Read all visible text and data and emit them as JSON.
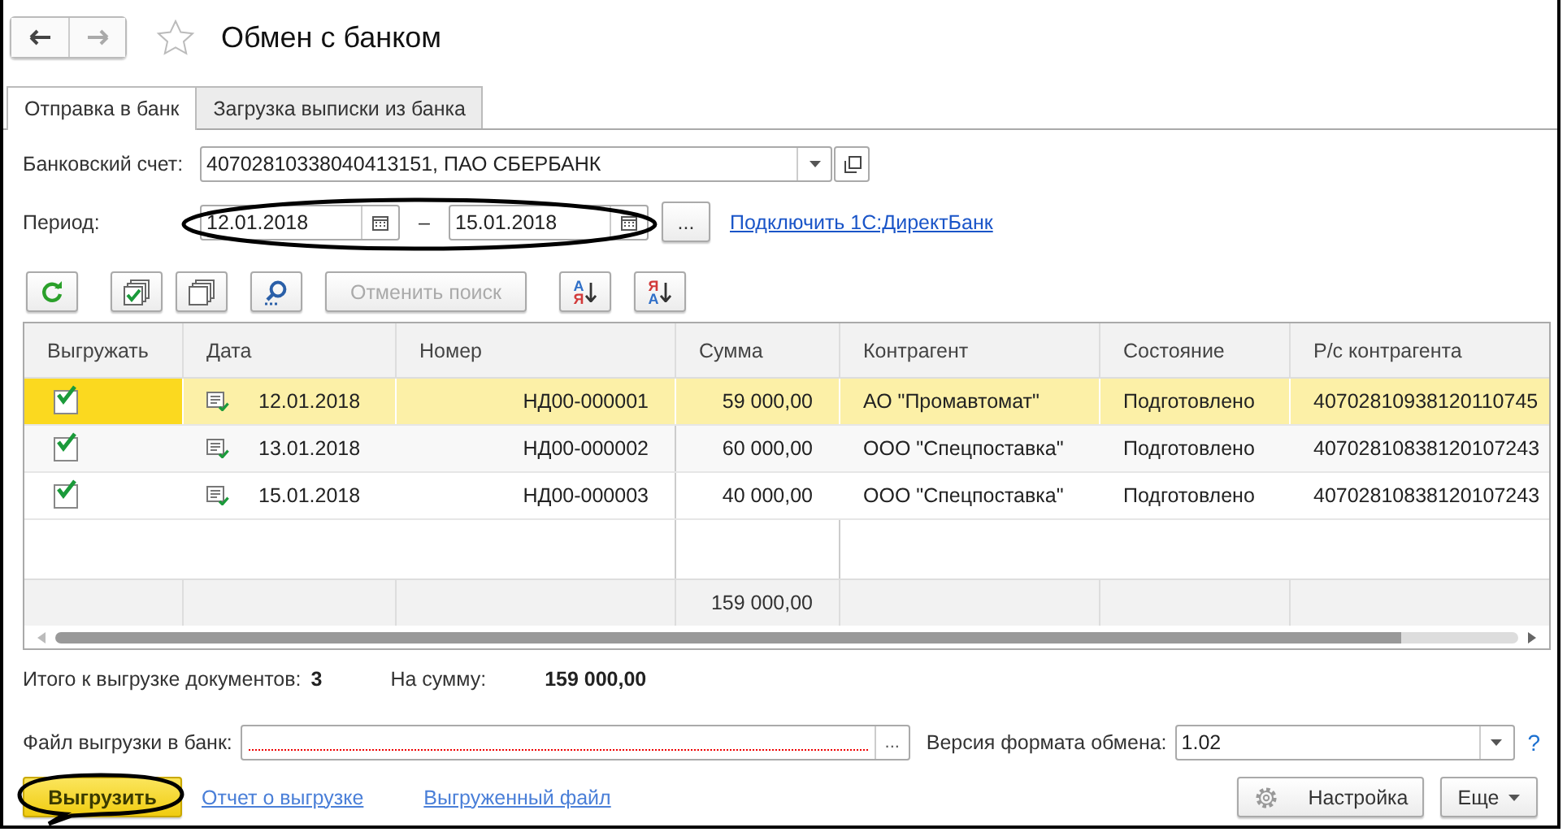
{
  "window": {
    "title": "Обмен с банком",
    "favorite": false
  },
  "tabs": [
    {
      "label": "Отправка в банк",
      "selected": true
    },
    {
      "label": "Загрузка выписки из банка",
      "selected": false
    }
  ],
  "bank_account": {
    "label": "Банковский счет:",
    "value": "40702810338040413151, ПАО СБЕРБАНК"
  },
  "period": {
    "label": "Период:",
    "from": "12.01.2018",
    "separator": "–",
    "to": "15.01.2018",
    "choose_button": "...",
    "circled": true,
    "link": "Подключить 1С:ДиректБанк"
  },
  "toolbar": [
    {
      "kind": "refresh"
    },
    {
      "kind": "check-all"
    },
    {
      "kind": "uncheck-all"
    },
    {
      "kind": "search"
    },
    {
      "kind": "text",
      "label": "Отменить поиск",
      "disabled": true
    },
    {
      "kind": "sort",
      "letters": [
        {
          "char": "А",
          "color": "#2f6fc8"
        },
        {
          "char": "Я",
          "color": "#d23a3a"
        }
      ]
    },
    {
      "kind": "sort",
      "letters": [
        {
          "char": "Я",
          "color": "#d23a3a"
        },
        {
          "char": "А",
          "color": "#2f6fc8"
        }
      ]
    }
  ],
  "table": {
    "columns": [
      "Выгружать",
      "Дата",
      "Номер",
      "Сумма",
      "Контрагент",
      "Состояние",
      "Р/с контрагента"
    ],
    "rows": [
      {
        "export": true,
        "date": "12.01.2018",
        "number": "НД00-000001",
        "sum": "59 000,00",
        "counterparty": "АО \"Промавтомат\"",
        "state": "Подготовлено",
        "account": "40702810938120110745",
        "selected": true
      },
      {
        "export": true,
        "date": "13.01.2018",
        "number": "НД00-000002",
        "sum": "60 000,00",
        "counterparty": "ООО \"Спецпоставка\"",
        "state": "Подготовлено",
        "account": "40702810838120107243",
        "selected": false
      },
      {
        "export": true,
        "date": "15.01.2018",
        "number": "НД00-000003",
        "sum": "40 000,00",
        "counterparty": "ООО \"Спецпоставка\"",
        "state": "Подготовлено",
        "account": "40702810838120107243",
        "selected": false
      }
    ],
    "totals": {
      "sum": "159 000,00"
    }
  },
  "summary": {
    "count_label": "Итого к выгрузке документов:",
    "count": "3",
    "sum_label": "На сумму:",
    "sum": "159 000,00"
  },
  "export_file": {
    "label": "Файл выгрузки в банк:",
    "required": true,
    "button": "..."
  },
  "format": {
    "label": "Версия формата обмена:",
    "value": "1.02",
    "help": "?"
  },
  "footer": {
    "export_button": {
      "label": "Выгрузить",
      "circled": true
    },
    "links": [
      "Отчет о выгрузке",
      "Выгруженный файл"
    ],
    "settings_button": "Настройка",
    "more_button": "Еще"
  }
}
